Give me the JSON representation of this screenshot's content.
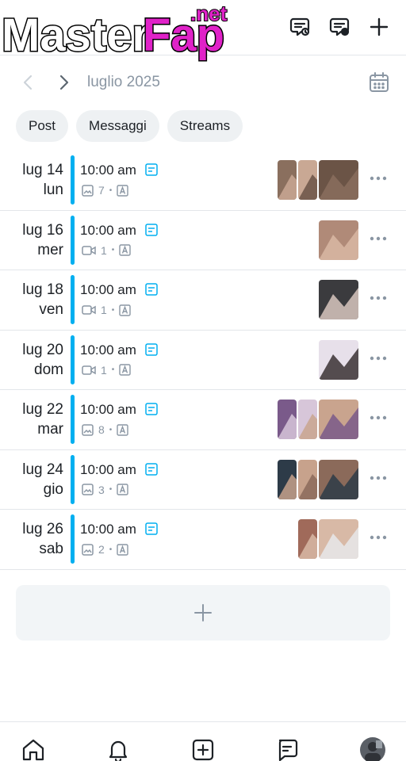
{
  "header": {
    "logo_text": "MasterFap",
    "logo_suffix": ".net",
    "actions": [
      "queue-icon",
      "saved-queue-icon",
      "plus-icon"
    ]
  },
  "month_nav": {
    "label": "luglio 2025",
    "icons": [
      "chevron-left-icon",
      "chevron-right-icon",
      "calendar-icon"
    ]
  },
  "filters": [
    {
      "label": "Post"
    },
    {
      "label": "Messaggi"
    },
    {
      "label": "Streams"
    }
  ],
  "posts": [
    {
      "date": "lug 14",
      "weekday": "lun",
      "time": "10:00 am",
      "media": "image",
      "count": "7",
      "thumbs": 3
    },
    {
      "date": "lug 16",
      "weekday": "mer",
      "time": "10:00 am",
      "media": "video",
      "count": "1",
      "thumbs": 1
    },
    {
      "date": "lug 18",
      "weekday": "ven",
      "time": "10:00 am",
      "media": "video",
      "count": "1",
      "thumbs": 1
    },
    {
      "date": "lug 20",
      "weekday": "dom",
      "time": "10:00 am",
      "media": "video",
      "count": "1",
      "thumbs": 1
    },
    {
      "date": "lug 22",
      "weekday": "mar",
      "time": "10:00 am",
      "media": "image",
      "count": "8",
      "thumbs": 3
    },
    {
      "date": "lug 24",
      "weekday": "gio",
      "time": "10:00 am",
      "media": "image",
      "count": "3",
      "thumbs": 3
    },
    {
      "date": "lug 26",
      "weekday": "sab",
      "time": "10:00 am",
      "media": "image",
      "count": "2",
      "thumbs": 2
    }
  ],
  "colors": {
    "accent": "#00aff0",
    "muted": "#8a96a3",
    "chip_bg": "#eef1f3"
  },
  "bottom_nav": [
    "home-icon",
    "bell-icon",
    "add-post-icon",
    "messages-icon",
    "profile-avatar"
  ]
}
